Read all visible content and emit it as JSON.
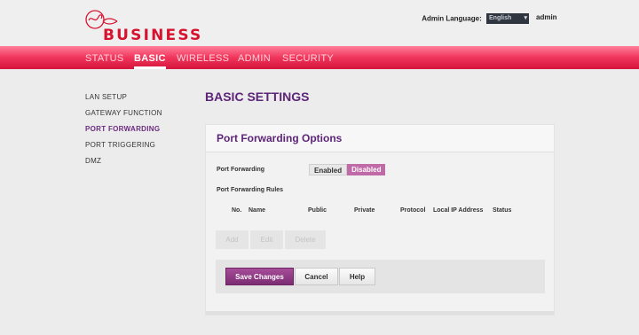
{
  "header": {
    "brand_name": "BUSINESS",
    "logo_icon": "virgin-logo-icon",
    "brand_color": "#d6122f",
    "admin_language_label": "Admin Language:",
    "language_value": "English",
    "user_name": "admin"
  },
  "nav": {
    "items": [
      {
        "label": "STATUS"
      },
      {
        "label": "BASIC"
      },
      {
        "label": "WIRELESS"
      },
      {
        "label": "ADMIN"
      },
      {
        "label": "SECURITY"
      }
    ],
    "active": "BASIC",
    "bar_color": "#f0355b"
  },
  "sidebar": {
    "items": [
      {
        "label": "LAN SETUP"
      },
      {
        "label": "GATEWAY FUNCTION"
      },
      {
        "label": "PORT FORWARDING"
      },
      {
        "label": "PORT TRIGGERING"
      },
      {
        "label": "DMZ"
      }
    ],
    "active": "PORT FORWARDING",
    "active_color": "#6c2c80"
  },
  "page": {
    "title": "BASIC SETTINGS"
  },
  "panel": {
    "title": "Port Forwarding Options",
    "port_forwarding_label": "Port Forwarding",
    "toggle": {
      "enabled_label": "Enabled",
      "disabled_label": "Disabled",
      "selected": "Disabled",
      "selected_color": "#c06aa8"
    },
    "rules_label": "Port Forwarding Rules",
    "columns": [
      "No.",
      "Name",
      "Public",
      "Private",
      "Protocol",
      "Local IP Address",
      "Status"
    ],
    "rows": [],
    "rule_buttons": {
      "add": "Add",
      "edit": "Edit",
      "delete": "Delete"
    },
    "actions": {
      "save": "Save Changes",
      "cancel": "Cancel",
      "help": "Help"
    }
  }
}
